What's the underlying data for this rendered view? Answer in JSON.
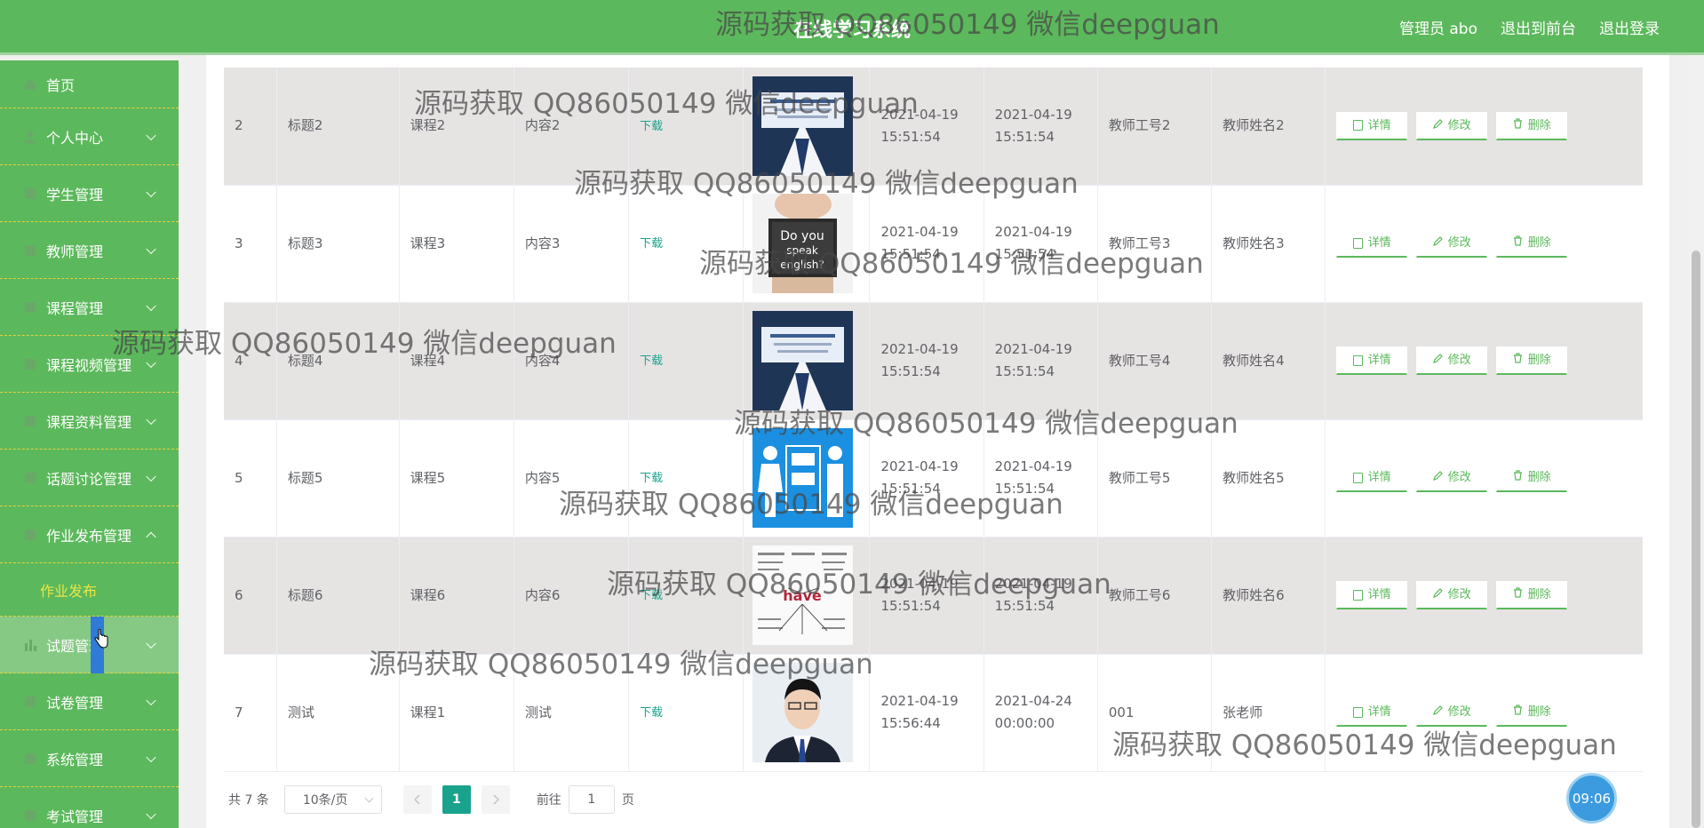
{
  "header": {
    "title": "在线学习系统",
    "nav": [
      "管理员 abo",
      "退出到前台",
      "退出登录"
    ]
  },
  "sidebar": {
    "items": [
      {
        "label": "首页",
        "icon": "home-icon"
      },
      {
        "label": "个人中心",
        "icon": "user-icon"
      },
      {
        "label": "学生管理",
        "icon": "student-icon"
      },
      {
        "label": "教师管理",
        "icon": "teacher-icon"
      },
      {
        "label": "课程管理",
        "icon": "course-icon"
      },
      {
        "label": "课程视频管理",
        "icon": "video-icon"
      },
      {
        "label": "课程资料管理",
        "icon": "document-icon"
      },
      {
        "label": "话题讨论管理",
        "icon": "discussion-icon"
      },
      {
        "label": "作业发布管理",
        "icon": "homework-icon"
      },
      {
        "label": "试题管理",
        "icon": "bar-chart-icon"
      },
      {
        "label": "试卷管理",
        "icon": "exam-paper-icon"
      },
      {
        "label": "系统管理",
        "icon": "system-icon"
      },
      {
        "label": "考试管理",
        "icon": "exam-icon"
      }
    ],
    "submenu": "作业发布"
  },
  "table": {
    "rows": [
      {
        "id": "2",
        "title": "标题2",
        "course": "课程2",
        "content": "内容2",
        "download": "下载",
        "start": "2021-04-19 15:51:54",
        "end": "2021-04-19 15:51:54",
        "teacher_no": "教师工号2",
        "teacher_name": "教师姓名2"
      },
      {
        "id": "3",
        "title": "标题3",
        "course": "课程3",
        "content": "内容3",
        "download": "下载",
        "start": "2021-04-19 15:51:54",
        "end": "2021-04-19 15:51:54",
        "teacher_no": "教师工号3",
        "teacher_name": "教师姓名3"
      },
      {
        "id": "4",
        "title": "标题4",
        "course": "课程4",
        "content": "内容4",
        "download": "下载",
        "start": "2021-04-19 15:51:54",
        "end": "2021-04-19 15:51:54",
        "teacher_no": "教师工号4",
        "teacher_name": "教师姓名4"
      },
      {
        "id": "5",
        "title": "标题5",
        "course": "课程5",
        "content": "内容5",
        "download": "下载",
        "start": "2021-04-19 15:51:54",
        "end": "2021-04-19 15:51:54",
        "teacher_no": "教师工号5",
        "teacher_name": "教师姓名5"
      },
      {
        "id": "6",
        "title": "标题6",
        "course": "课程6",
        "content": "内容6",
        "download": "下载",
        "start": "2021-04-19 15:51:54",
        "end": "2021-04-19 15:51:54",
        "teacher_no": "教师工号6",
        "teacher_name": "教师姓名6"
      },
      {
        "id": "7",
        "title": "测试",
        "course": "课程1",
        "content": "测试",
        "download": "下载",
        "start": "2021-04-19 15:56:44",
        "end": "2021-04-24 00:00:00",
        "teacher_no": "001",
        "teacher_name": "张老师"
      }
    ],
    "actions": {
      "detail": "详情",
      "edit": "修改",
      "delete": "删除"
    }
  },
  "pagination": {
    "total": "共 7 条",
    "page_size": "10条/页",
    "current": "1",
    "goto": "前往",
    "goto_value": "1",
    "page_unit": "页"
  },
  "clock": "09:06",
  "watermark": "源码获取 QQ86050149 微信deepguan",
  "colors": {
    "header": "#5cb85c",
    "sidebar": "#5cb85c",
    "accent": "#1aa38c"
  }
}
